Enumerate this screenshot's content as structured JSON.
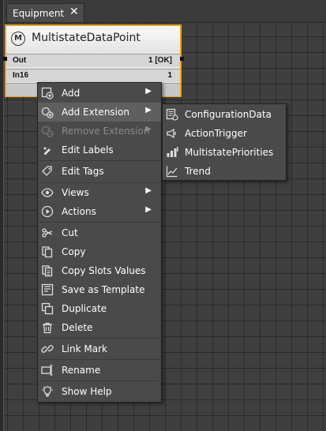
{
  "tab": {
    "title": "Equipment",
    "close_glyph": "✕"
  },
  "node": {
    "title": "MultistateDataPoint",
    "icon_letter": "M",
    "slots": [
      {
        "name": "Out",
        "value": "1 [OK]"
      },
      {
        "name": "In16",
        "value": "1"
      }
    ]
  },
  "menu": {
    "items": [
      {
        "label": "Add",
        "icon": "add-icon",
        "submenu": true
      },
      {
        "label": "Add Extension",
        "icon": "add-extension-icon",
        "submenu": true,
        "highlighted": true
      },
      {
        "label": "Remove Extension",
        "icon": "remove-extension-icon",
        "submenu": true,
        "disabled": true
      },
      {
        "label": "Edit Labels",
        "icon": "edit-labels-icon"
      },
      {
        "label": "Edit Tags",
        "icon": "edit-tags-icon"
      },
      {
        "label": "Views",
        "icon": "views-icon",
        "submenu": true
      },
      {
        "label": "Actions",
        "icon": "actions-icon",
        "submenu": true
      },
      {
        "label": "Cut",
        "icon": "cut-icon"
      },
      {
        "label": "Copy",
        "icon": "copy-icon"
      },
      {
        "label": "Copy Slots Values",
        "icon": "copy-slots-values-icon"
      },
      {
        "label": "Save as Template",
        "icon": "save-as-template-icon"
      },
      {
        "label": "Duplicate",
        "icon": "duplicate-icon"
      },
      {
        "label": "Delete",
        "icon": "delete-icon"
      },
      {
        "label": "Link Mark",
        "icon": "link-mark-icon"
      },
      {
        "label": "Rename",
        "icon": "rename-icon"
      },
      {
        "label": "Show Help",
        "icon": "show-help-icon"
      }
    ]
  },
  "submenu": {
    "items": [
      {
        "label": "ConfigurationData",
        "icon": "configuration-data-icon"
      },
      {
        "label": "ActionTrigger",
        "icon": "action-trigger-icon"
      },
      {
        "label": "MultistatePriorities",
        "icon": "multistate-priorities-icon"
      },
      {
        "label": "Trend",
        "icon": "trend-icon"
      }
    ]
  },
  "colors": {
    "canvas": "#3f3f3f",
    "selection_border": "#f0a21f",
    "menu_bg": "#4a4a4a",
    "menu_highlight": "#5f5f5f",
    "disabled_text": "#8a8a8a"
  }
}
